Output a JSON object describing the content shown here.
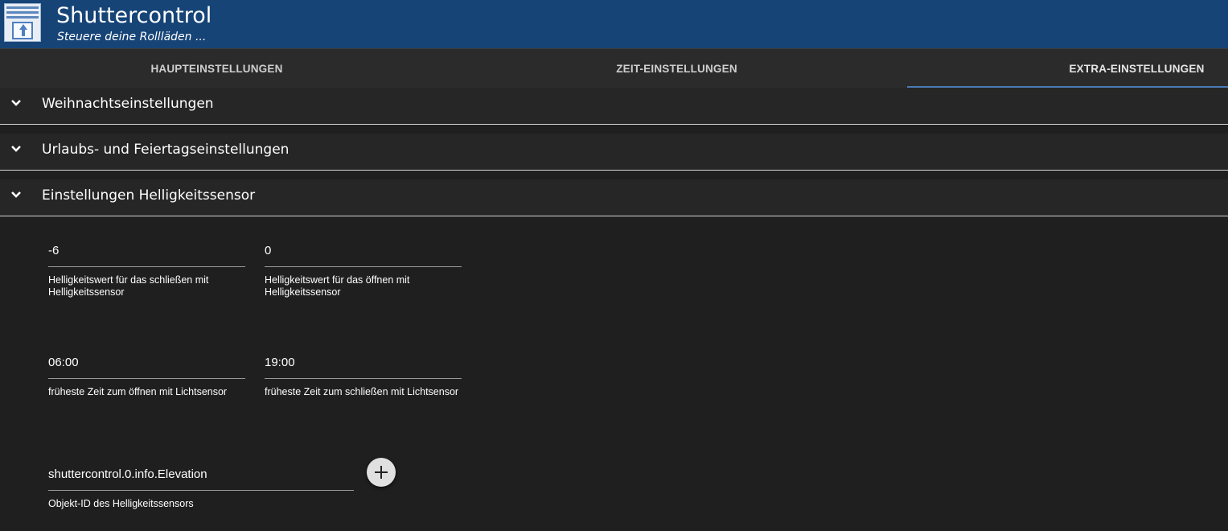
{
  "app": {
    "title": "Shuttercontrol",
    "subtitle": "Steuere deine Rollläden ..."
  },
  "tabs": [
    {
      "label": "HAUPTEINSTELLUNGEN",
      "active": false
    },
    {
      "label": "ZEIT-EINSTELLUNGEN",
      "active": false
    },
    {
      "label": "EXTRA-EINSTELLUNGEN",
      "active": true
    }
  ],
  "panels": [
    {
      "label": "Weihnachtseinstellungen",
      "expanded": false
    },
    {
      "label": "Urlaubs- und Feiertagseinstellungen",
      "expanded": false
    },
    {
      "label": "Einstellungen Helligkeitssensor",
      "expanded": true
    }
  ],
  "brightness": {
    "close_value": "-6",
    "close_help": "Helligkeitswert für das schließen mit Helligkeitssensor",
    "open_value": "0",
    "open_help": "Helligkeitswert für das öffnen mit Helligkeitssensor",
    "earliest_open_value": "06:00",
    "earliest_open_help": "früheste Zeit zum öffnen mit Lichtsensor",
    "earliest_close_value": "19:00",
    "earliest_close_help": "früheste Zeit zum schließen mit Lichtsensor",
    "object_id_value": "shuttercontrol.0.info.Elevation",
    "object_id_help": "Objekt-ID des Helligkeitssensors"
  },
  "icons": {
    "logo": "shutter-logo-icon",
    "chevron": "chevron-down-icon",
    "add": "plus-icon"
  },
  "colors": {
    "header": "#164477",
    "accent": "#4a7bb6",
    "background": "#1f1f1f"
  }
}
